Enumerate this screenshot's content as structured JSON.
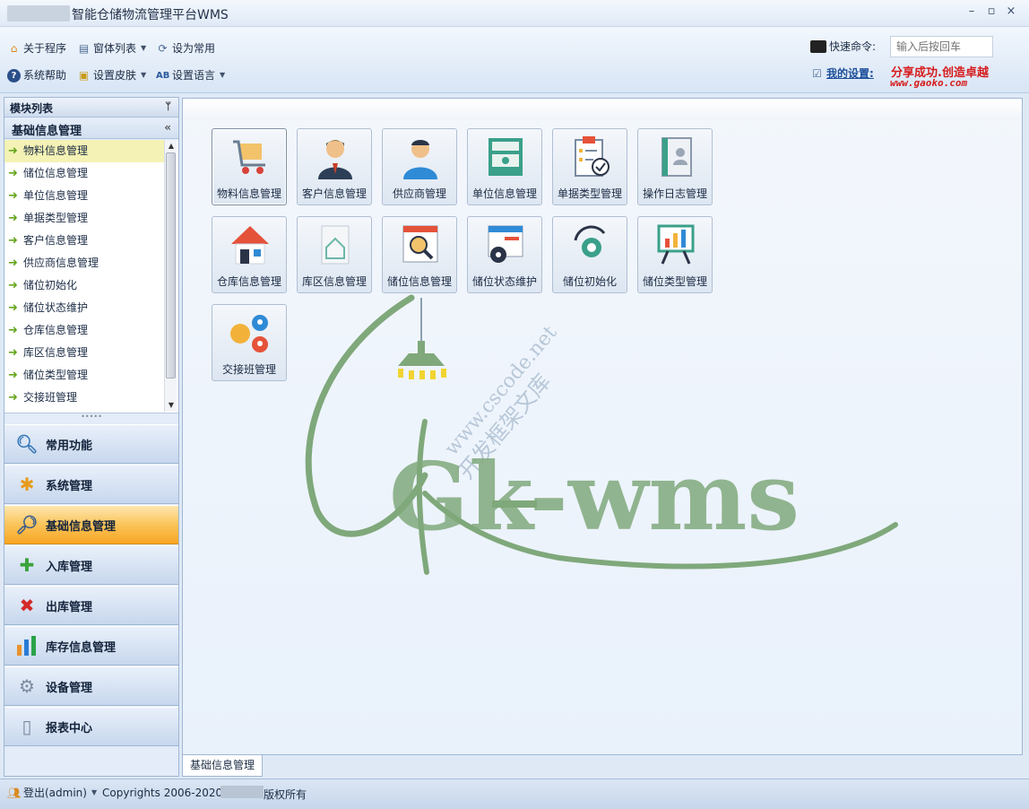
{
  "window": {
    "title": "智能仓储物流管理平台WMS",
    "minimize": "–",
    "maximize": "▫",
    "close": "×"
  },
  "toolbar": {
    "about": "关于程序",
    "window_list": "窗体列表",
    "set_common": "设为常用",
    "help": "系统帮助",
    "skin": "设置皮肤",
    "language": "设置语言",
    "quick_command_label": "快速命令:",
    "quick_command_placeholder": "输入后按回车",
    "my_settings": "我的设置:",
    "slogan": "分享成功.创造卓越",
    "slogan_url": "www.gaoko.com"
  },
  "sidebar": {
    "header": "模块列表",
    "group": "基础信息管理",
    "items": [
      "物料信息管理",
      "储位信息管理",
      "单位信息管理",
      "单据类型管理",
      "客户信息管理",
      "供应商信息管理",
      "储位初始化",
      "储位状态维护",
      "仓库信息管理",
      "库区信息管理",
      "储位类型管理",
      "交接班管理"
    ],
    "nav": [
      "常用功能",
      "系统管理",
      "基础信息管理",
      "入库管理",
      "出库管理",
      "库存信息管理",
      "设备管理",
      "报表中心"
    ]
  },
  "tiles": [
    "物料信息管理",
    "客户信息管理",
    "供应商管理",
    "单位信息管理",
    "单据类型管理",
    "操作日志管理",
    "仓库信息管理",
    "库区信息管理",
    "储位信息管理",
    "储位状态维护",
    "储位初始化",
    "储位类型管理",
    "交接班管理"
  ],
  "watermark": {
    "text": "Gk-wms",
    "site": "www.cscode.net",
    "site_cn": "开发框架文库"
  },
  "tab": "基础信息管理",
  "status": {
    "login": "登出(admin)",
    "copyright": "Copyrights 2006-2020",
    "rights": "版权所有"
  },
  "colors": {
    "accent_active": "#f7a623",
    "brand_red": "#d61b1b",
    "watermark_green": "#7fa87b"
  }
}
